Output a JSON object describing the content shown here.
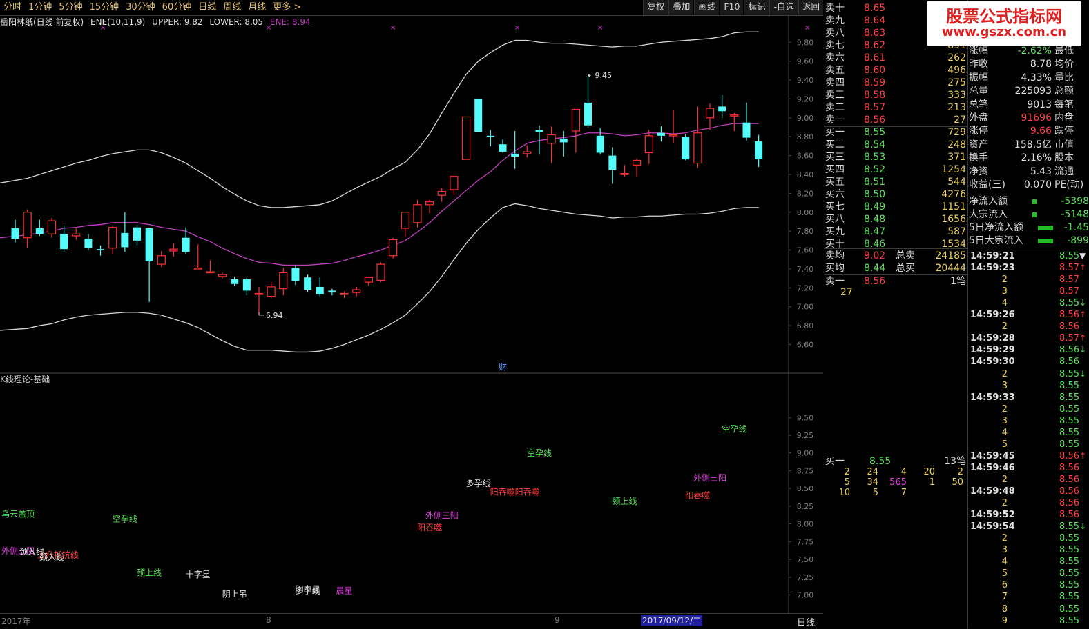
{
  "toolbar": {
    "tabs": [
      "分时",
      "1分钟",
      "5分钟",
      "15分钟",
      "30分钟",
      "60分钟",
      "日线",
      "周线",
      "月线",
      "更多 >"
    ],
    "tools": [
      "复权",
      "叠加",
      "画线",
      "F10",
      "标记",
      "-自选",
      "返回"
    ]
  },
  "indicator_line": {
    "name": "岳阳林纸(日线 前复权)",
    "ene_params": "ENE(10,11,9)",
    "upper_label": "UPPER: 9.82",
    "lower_label": "LOWER: 8.05",
    "ene_label": "ENE: 8.94"
  },
  "subchart_title": "K线理论-基础",
  "bottom_axis": {
    "labels": [
      "2017年",
      "8",
      "9"
    ],
    "cursor_date": "2017/09/12/二",
    "period_button": "日线"
  },
  "price_axis_ticks": [
    "9.80",
    "9.60",
    "9.40",
    "9.20",
    "9.00",
    "8.80",
    "8.60",
    "8.40",
    "8.20",
    "8.00",
    "7.80",
    "7.60",
    "7.40",
    "7.20",
    "7.00",
    "6.80",
    "6.60"
  ],
  "sub_axis_ticks": [
    "9.50",
    "9.25",
    "9.00",
    "8.75",
    "8.50",
    "8.25",
    "8.00",
    "7.75",
    "7.50",
    "7.25",
    "7.00"
  ],
  "colors": {
    "up": "#ff3030",
    "down": "#54fcfc",
    "band": "#d8d8d8",
    "mid": "#c040c0",
    "marker": "#e040e0"
  },
  "chart_data": {
    "type": "candlestick",
    "ylim": [
      6.45,
      9.97
    ],
    "ohlc": [
      [
        7.83,
        7.92,
        7.68,
        7.72
      ],
      [
        7.73,
        8.03,
        7.62,
        8.0
      ],
      [
        7.83,
        7.92,
        7.75,
        7.77
      ],
      [
        7.77,
        7.94,
        7.73,
        7.91
      ],
      [
        7.77,
        7.86,
        7.58,
        7.61
      ],
      [
        7.75,
        7.83,
        7.71,
        7.77
      ],
      [
        7.72,
        7.77,
        7.6,
        7.62
      ],
      [
        7.61,
        7.65,
        7.54,
        7.6
      ],
      [
        7.62,
        7.86,
        7.56,
        7.84
      ],
      [
        7.78,
        8.0,
        7.58,
        7.63
      ],
      [
        7.84,
        7.87,
        7.65,
        7.7
      ],
      [
        7.83,
        7.83,
        7.05,
        7.48
      ],
      [
        7.45,
        7.59,
        7.42,
        7.54
      ],
      [
        7.59,
        7.67,
        7.53,
        7.61
      ],
      [
        7.73,
        7.84,
        7.56,
        7.58
      ],
      [
        7.41,
        7.66,
        7.41,
        7.41
      ],
      [
        7.37,
        7.49,
        7.36,
        7.37
      ],
      [
        7.32,
        7.36,
        7.3,
        7.34
      ],
      [
        7.29,
        7.32,
        7.22,
        7.24
      ],
      [
        7.29,
        7.31,
        7.12,
        7.17
      ],
      [
        7.14,
        7.21,
        6.94,
        7.14
      ],
      [
        7.11,
        7.26,
        7.09,
        7.21
      ],
      [
        7.19,
        7.41,
        7.12,
        7.36
      ],
      [
        7.41,
        7.44,
        7.23,
        7.27
      ],
      [
        7.31,
        7.34,
        7.15,
        7.18
      ],
      [
        7.21,
        7.31,
        7.11,
        7.13
      ],
      [
        7.17,
        7.19,
        7.12,
        7.15
      ],
      [
        7.13,
        7.16,
        7.09,
        7.14
      ],
      [
        7.15,
        7.21,
        7.11,
        7.18
      ],
      [
        7.26,
        7.31,
        7.22,
        7.31
      ],
      [
        7.28,
        7.47,
        7.26,
        7.45
      ],
      [
        7.54,
        7.73,
        7.51,
        7.71
      ],
      [
        7.83,
        7.94,
        7.74,
        8.0
      ],
      [
        7.89,
        8.13,
        7.84,
        8.08
      ],
      [
        8.08,
        8.13,
        7.99,
        8.11
      ],
      [
        8.18,
        8.26,
        8.11,
        8.22
      ],
      [
        8.24,
        8.36,
        8.18,
        8.38
      ],
      [
        8.56,
        8.99,
        8.56,
        9.01
      ],
      [
        9.2,
        9.2,
        8.87,
        8.85
      ],
      [
        8.81,
        8.87,
        8.7,
        8.8
      ],
      [
        8.72,
        8.77,
        8.63,
        8.64
      ],
      [
        8.62,
        8.86,
        8.46,
        8.59
      ],
      [
        8.62,
        8.71,
        8.58,
        8.64
      ],
      [
        8.87,
        8.92,
        8.61,
        8.85
      ],
      [
        8.73,
        8.91,
        8.52,
        8.82
      ],
      [
        8.78,
        8.86,
        8.59,
        8.74
      ],
      [
        8.86,
        9.04,
        8.63,
        9.09
      ],
      [
        9.16,
        9.45,
        8.9,
        8.92
      ],
      [
        8.81,
        8.89,
        8.61,
        8.63
      ],
      [
        8.6,
        8.69,
        8.3,
        8.45
      ],
      [
        8.4,
        8.5,
        8.38,
        8.41
      ],
      [
        8.5,
        8.57,
        8.38,
        8.55
      ],
      [
        8.63,
        8.87,
        8.51,
        8.81
      ],
      [
        8.84,
        8.91,
        8.75,
        8.81
      ],
      [
        8.81,
        9.08,
        8.73,
        8.82
      ],
      [
        8.8,
        8.83,
        8.55,
        8.56
      ],
      [
        8.52,
        9.12,
        8.47,
        8.84
      ],
      [
        9.0,
        9.15,
        8.87,
        9.1
      ],
      [
        9.12,
        9.24,
        9.0,
        9.07
      ],
      [
        9.03,
        9.05,
        8.86,
        9.03
      ],
      [
        8.95,
        9.16,
        8.76,
        8.79
      ],
      [
        8.75,
        8.82,
        8.48,
        8.56
      ]
    ],
    "upper": [
      8.31,
      8.36,
      8.4,
      8.44,
      8.48,
      8.52,
      8.55,
      8.59,
      8.62,
      8.64,
      8.66,
      8.66,
      8.63,
      8.58,
      8.52,
      8.44,
      8.36,
      8.27,
      8.19,
      8.12,
      8.07,
      8.05,
      8.05,
      8.06,
      8.07,
      8.08,
      8.12,
      8.19,
      8.26,
      8.32,
      8.38,
      8.46,
      8.53,
      8.66,
      8.83,
      9.05,
      9.26,
      9.46,
      9.6,
      9.69,
      9.77,
      9.82,
      9.82,
      9.8,
      9.79,
      9.79,
      9.78,
      9.77,
      9.76,
      9.75,
      9.76,
      9.76,
      9.78,
      9.8,
      9.81,
      9.82,
      9.83,
      9.84,
      9.86,
      9.9,
      9.91,
      9.91
    ],
    "mid": [
      7.73,
      7.76,
      7.78,
      7.8,
      7.83,
      7.84,
      7.86,
      7.87,
      7.89,
      7.89,
      7.89,
      7.87,
      7.84,
      7.82,
      7.8,
      7.74,
      7.69,
      7.62,
      7.56,
      7.51,
      7.47,
      7.46,
      7.44,
      7.44,
      7.44,
      7.45,
      7.46,
      7.49,
      7.53,
      7.56,
      7.6,
      7.65,
      7.7,
      7.79,
      7.89,
      8.01,
      8.12,
      8.23,
      8.34,
      8.43,
      8.55,
      8.65,
      8.73,
      8.76,
      8.78,
      8.79,
      8.81,
      8.84,
      8.84,
      8.83,
      8.81,
      8.82,
      8.84,
      8.84,
      8.83,
      8.84,
      8.87,
      8.89,
      8.92,
      8.94,
      8.94,
      8.94
    ],
    "lower": [
      6.75,
      6.77,
      6.8,
      6.82,
      6.86,
      6.89,
      6.91,
      6.92,
      6.93,
      6.94,
      6.94,
      6.93,
      6.91,
      6.87,
      6.83,
      6.78,
      6.71,
      6.64,
      6.58,
      6.54,
      6.54,
      6.54,
      6.53,
      6.52,
      6.52,
      6.53,
      6.56,
      6.6,
      6.65,
      6.7,
      6.76,
      6.83,
      6.91,
      7.03,
      7.16,
      7.32,
      7.5,
      7.67,
      7.82,
      7.94,
      8.05,
      8.09,
      8.07,
      8.04,
      8.02,
      8.0,
      7.98,
      7.97,
      7.96,
      7.94,
      7.95,
      7.95,
      7.96,
      7.96,
      7.97,
      7.98,
      7.98,
      7.99,
      8.01,
      8.04,
      8.05,
      8.05
    ],
    "high_marker": "9.45",
    "low_marker": "6.94",
    "signal_marks": [
      3,
      7,
      10,
      13,
      15,
      20,
      27,
      30,
      31,
      35,
      40,
      41,
      42,
      43,
      47,
      50,
      51,
      52
    ],
    "fin_marker": "财",
    "patterns": [
      {
        "text": "乌云盖顶",
        "x": 0,
        "y": 8.1,
        "color": "#54e054"
      },
      {
        "text": "外侧三阳",
        "x": 0,
        "y": 7.58,
        "color": "#e040e0"
      },
      {
        "text": "颈入线",
        "x": 1,
        "y": 7.57,
        "color": "#e0e0e0"
      },
      {
        "text": "上升抵抗线",
        "x": 2,
        "y": 7.52,
        "color": "#ff4040"
      },
      {
        "text": "颈入线",
        "x": 3,
        "y": 7.49,
        "color": "#e0e0e0"
      },
      {
        "text": "空孕线",
        "x": 9,
        "y": 8.03,
        "color": "#54e054"
      },
      {
        "text": "颈上线",
        "x": 11,
        "y": 7.27,
        "color": "#54e054"
      },
      {
        "text": "十字星",
        "x": 15,
        "y": 7.25,
        "color": "#e0e0e0"
      },
      {
        "text": "阴上吊",
        "x": 18,
        "y": 6.97,
        "color": "#e0e0e0"
      },
      {
        "text": "阴中星",
        "x": 24,
        "y": 7.04,
        "color": "#e0e0e0"
      },
      {
        "text": "多孕线",
        "x": 24,
        "y": 7.02,
        "color": "#e0e0e0"
      },
      {
        "text": "晨星",
        "x": 27,
        "y": 7.02,
        "color": "#e040e0"
      },
      {
        "text": "阳吞噬",
        "x": 34,
        "y": 7.91,
        "color": "#ff4040"
      },
      {
        "text": "外侧三阳",
        "x": 35,
        "y": 8.08,
        "color": "#e040e0"
      },
      {
        "text": "多孕线",
        "x": 38,
        "y": 8.53,
        "color": "#e0e0e0"
      },
      {
        "text": "阳吞噬阳吞噬",
        "x": 41,
        "y": 8.41,
        "color": "#ff4040"
      },
      {
        "text": "空孕线",
        "x": 43,
        "y": 8.96,
        "color": "#54e054"
      },
      {
        "text": "颈上线",
        "x": 50,
        "y": 8.28,
        "color": "#54e054"
      },
      {
        "text": "阳吞噬",
        "x": 56,
        "y": 8.36,
        "color": "#ff4040"
      },
      {
        "text": "外侧三阳",
        "x": 57,
        "y": 8.61,
        "color": "#e040e0"
      },
      {
        "text": "空孕线",
        "x": 59,
        "y": 9.3,
        "color": "#54e054"
      }
    ],
    "sub_ylim": [
      6.83,
      9.94
    ]
  },
  "order_book": {
    "asks": [
      {
        "label": "卖十",
        "price": "8.65",
        "vol": "",
        "c": "r"
      },
      {
        "label": "卖九",
        "price": "8.64",
        "vol": "",
        "c": "r"
      },
      {
        "label": "卖八",
        "price": "8.63",
        "vol": "",
        "c": "r"
      },
      {
        "label": "卖七",
        "price": "8.62",
        "vol": "891",
        "c": "r"
      },
      {
        "label": "卖六",
        "price": "8.61",
        "vol": "262",
        "c": "r"
      },
      {
        "label": "卖五",
        "price": "8.60",
        "vol": "496",
        "c": "r"
      },
      {
        "label": "卖四",
        "price": "8.59",
        "vol": "275",
        "c": "r"
      },
      {
        "label": "卖三",
        "price": "8.58",
        "vol": "333",
        "c": "r"
      },
      {
        "label": "卖二",
        "price": "8.57",
        "vol": "213",
        "c": "r"
      },
      {
        "label": "卖一",
        "price": "8.56",
        "vol": "27",
        "c": "r"
      }
    ],
    "bids": [
      {
        "label": "买一",
        "price": "8.55",
        "vol": "729",
        "c": "g"
      },
      {
        "label": "买二",
        "price": "8.54",
        "vol": "248",
        "c": "g"
      },
      {
        "label": "买三",
        "price": "8.53",
        "vol": "371",
        "c": "g"
      },
      {
        "label": "买四",
        "price": "8.52",
        "vol": "1254",
        "c": "g"
      },
      {
        "label": "买五",
        "price": "8.51",
        "vol": "544",
        "c": "g"
      },
      {
        "label": "买六",
        "price": "8.50",
        "vol": "4276",
        "c": "g"
      },
      {
        "label": "买七",
        "price": "8.49",
        "vol": "1151",
        "c": "g"
      },
      {
        "label": "买八",
        "price": "8.48",
        "vol": "1656",
        "c": "g"
      },
      {
        "label": "买九",
        "price": "8.47",
        "vol": "587",
        "c": "g"
      },
      {
        "label": "买十",
        "price": "8.46",
        "vol": "1534",
        "c": "g"
      }
    ],
    "avg_sell_label": "卖均",
    "avg_sell": "9.02",
    "total_sell_label": "总卖",
    "total_sell": "24185",
    "avg_buy_label": "买均",
    "avg_buy": "8.44",
    "total_buy_label": "总买",
    "total_buy": "20444",
    "sell1_label": "卖一",
    "sell1_price": "8.56",
    "sell1_count": "1笔",
    "sell1_queue": "27",
    "buy1_label": "买一",
    "buy1_price": "8.55",
    "buy1_count": "13笔",
    "buy1_queue": [
      [
        "2",
        "24",
        "4",
        "20",
        "2"
      ],
      [
        "5",
        "34",
        "565",
        "1",
        "50"
      ],
      [
        "10",
        "5",
        "7",
        "",
        ""
      ]
    ]
  },
  "stats": [
    {
      "k1": "涨幅",
      "v1": "-2.62%",
      "c": "g",
      "k2": "最低"
    },
    {
      "k1": "昨收",
      "v1": "8.78",
      "c": "w",
      "k2": "均价"
    },
    {
      "k1": "振幅",
      "v1": "4.33%",
      "c": "w",
      "k2": "量比"
    },
    {
      "k1": "总量",
      "v1": "225093",
      "c": "w",
      "k2": "总额"
    },
    {
      "k1": "总笔",
      "v1": "9013",
      "c": "w",
      "k2": "每笔"
    },
    {
      "k1": "外盘",
      "v1": "91696",
      "c": "r",
      "k2": "内盘"
    },
    {
      "k1": "涨停",
      "v1": "9.66",
      "c": "r",
      "k2": "跌停"
    },
    {
      "k1": "资产",
      "v1": "158.5亿",
      "c": "w",
      "k2": "市值"
    },
    {
      "k1": "换手",
      "v1": "2.16%",
      "c": "w",
      "k2": "股本"
    },
    {
      "k1": "净资",
      "v1": "5.43",
      "c": "w",
      "k2": "流通"
    },
    {
      "k1": "收益(三)",
      "v1": "0.070",
      "c": "w",
      "k2": "PE(动)"
    }
  ],
  "flows": [
    {
      "k": "净流入额",
      "v": "-5398"
    },
    {
      "k": "大宗流入",
      "v": "-5148"
    },
    {
      "k": "5日净流入额",
      "v": "-1.45"
    },
    {
      "k": "5日大宗流入",
      "v": "-899"
    }
  ],
  "ticks": [
    {
      "t": "14:59:21",
      "n": "",
      "p": "8.55",
      "c": "g",
      "a": "▼"
    },
    {
      "t": "14:59:23",
      "n": "",
      "p": "8.57",
      "c": "r",
      "a": "↑"
    },
    {
      "t": "",
      "n": "2",
      "p": "8.57",
      "c": "r",
      "a": ""
    },
    {
      "t": "",
      "n": "3",
      "p": "8.57",
      "c": "r",
      "a": ""
    },
    {
      "t": "",
      "n": "4",
      "p": "8.55",
      "c": "g",
      "a": "↓"
    },
    {
      "t": "14:59:26",
      "n": "",
      "p": "8.56",
      "c": "r",
      "a": "↑"
    },
    {
      "t": "",
      "n": "2",
      "p": "8.56",
      "c": "r",
      "a": ""
    },
    {
      "t": "14:59:28",
      "n": "",
      "p": "8.57",
      "c": "r",
      "a": "↑"
    },
    {
      "t": "14:59:29",
      "n": "",
      "p": "8.56",
      "c": "g",
      "a": "↓"
    },
    {
      "t": "14:59:30",
      "n": "",
      "p": "8.56",
      "c": "g",
      "a": ""
    },
    {
      "t": "",
      "n": "2",
      "p": "8.55",
      "c": "g",
      "a": "↓"
    },
    {
      "t": "",
      "n": "3",
      "p": "8.55",
      "c": "g",
      "a": ""
    },
    {
      "t": "14:59:33",
      "n": "",
      "p": "8.55",
      "c": "g",
      "a": ""
    },
    {
      "t": "",
      "n": "2",
      "p": "8.55",
      "c": "g",
      "a": ""
    },
    {
      "t": "",
      "n": "3",
      "p": "8.55",
      "c": "g",
      "a": ""
    },
    {
      "t": "",
      "n": "4",
      "p": "8.55",
      "c": "g",
      "a": ""
    },
    {
      "t": "",
      "n": "5",
      "p": "8.55",
      "c": "g",
      "a": ""
    },
    {
      "t": "14:59:45",
      "n": "",
      "p": "8.56",
      "c": "r",
      "a": "↑"
    },
    {
      "t": "14:59:46",
      "n": "",
      "p": "8.56",
      "c": "r",
      "a": ""
    },
    {
      "t": "",
      "n": "2",
      "p": "8.56",
      "c": "r",
      "a": ""
    },
    {
      "t": "14:59:48",
      "n": "",
      "p": "8.56",
      "c": "r",
      "a": ""
    },
    {
      "t": "",
      "n": "2",
      "p": "8.56",
      "c": "r",
      "a": ""
    },
    {
      "t": "14:59:52",
      "n": "",
      "p": "8.56",
      "c": "r",
      "a": ""
    },
    {
      "t": "14:59:54",
      "n": "",
      "p": "8.55",
      "c": "g",
      "a": "↓"
    },
    {
      "t": "",
      "n": "2",
      "p": "8.55",
      "c": "g",
      "a": ""
    },
    {
      "t": "",
      "n": "3",
      "p": "8.55",
      "c": "g",
      "a": ""
    },
    {
      "t": "",
      "n": "4",
      "p": "8.55",
      "c": "g",
      "a": ""
    },
    {
      "t": "",
      "n": "5",
      "p": "8.55",
      "c": "g",
      "a": ""
    },
    {
      "t": "",
      "n": "6",
      "p": "8.55",
      "c": "g",
      "a": ""
    },
    {
      "t": "",
      "n": "7",
      "p": "8.55",
      "c": "g",
      "a": ""
    },
    {
      "t": "",
      "n": "8",
      "p": "8.55",
      "c": "g",
      "a": ""
    },
    {
      "t": "",
      "n": "9",
      "p": "8.55",
      "c": "g",
      "a": ""
    }
  ],
  "watermark": {
    "line1": "股票公式指标网",
    "line2": "www.gszx.com.cn"
  }
}
